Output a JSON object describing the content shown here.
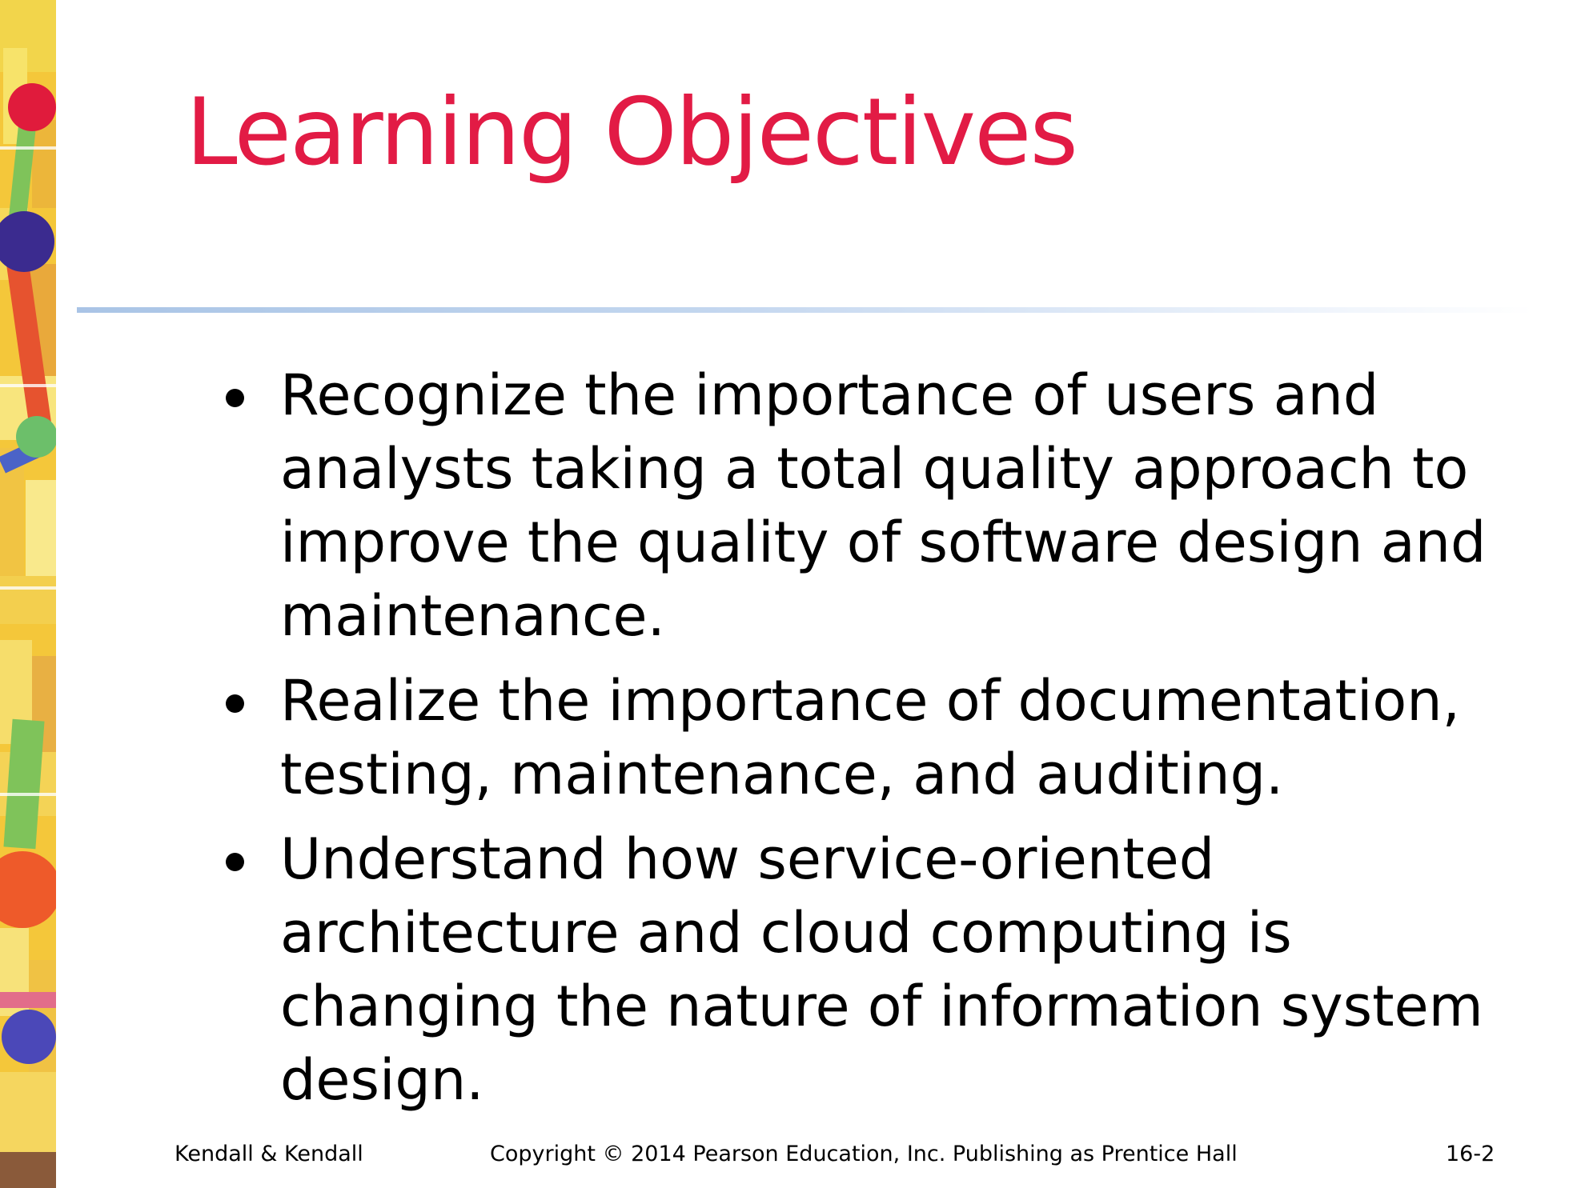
{
  "slide": {
    "title": "Learning Objectives",
    "title_color": "#e21b45",
    "bullets": [
      "Recognize the importance of users and analysts taking a total quality approach to improve the quality of software design and maintenance.",
      "Realize the importance of documentation, testing, maintenance, and auditing.",
      "Understand how service-oriented architecture and cloud computing is changing the nature of information system design."
    ]
  },
  "footer": {
    "left": "Kendall & Kendall",
    "center": "Copyright © 2014 Pearson Education, Inc. Publishing as Prentice Hall",
    "right": "16-2"
  }
}
